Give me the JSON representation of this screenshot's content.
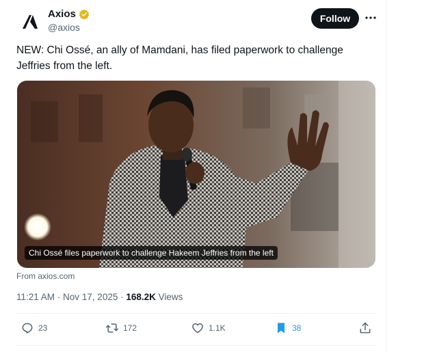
{
  "author": {
    "name": "Axios",
    "handle": "@axios",
    "logo_letter": "Λ",
    "verified_color": "#e2b719"
  },
  "follow_label": "Follow",
  "more_icon": "more-horizontal-icon",
  "tweet": {
    "text": "NEW: Chi Ossé, an ally of Mamdani, has filed paperwork to challenge Jeffries from the left."
  },
  "media": {
    "caption": "Chi Ossé files paperwork to challenge Hakeem Jeffries from the left",
    "source": "From axios.com"
  },
  "meta": {
    "timestamp": "11:21 AM · Nov 17, 2025 · ",
    "views_count": "168.2K",
    "views_label": " Views"
  },
  "actions": {
    "replies": "23",
    "reposts": "172",
    "likes": "1.1K",
    "bookmarks": "38"
  },
  "colors": {
    "text": "#0f1419",
    "secondary": "#536471",
    "accent": "#1d9bf0",
    "divider": "#eff3f4"
  }
}
